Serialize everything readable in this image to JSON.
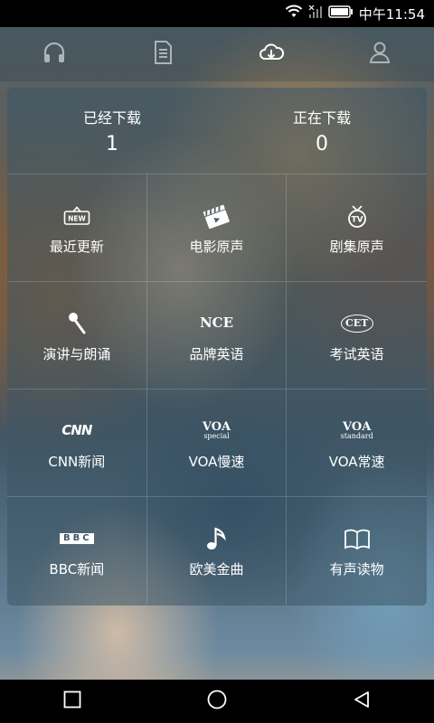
{
  "status_bar": {
    "time": "中午11:54"
  },
  "top_tabs": [
    {
      "name": "headphones"
    },
    {
      "name": "document"
    },
    {
      "name": "cloud-download"
    },
    {
      "name": "user"
    }
  ],
  "downloads": {
    "downloaded_label": "已经下载",
    "downloaded_count": "1",
    "downloading_label": "正在下载",
    "downloading_count": "0"
  },
  "categories": [
    {
      "label": "最近更新",
      "icon": "new-badge"
    },
    {
      "label": "电影原声",
      "icon": "clapperboard"
    },
    {
      "label": "剧集原声",
      "icon": "tv"
    },
    {
      "label": "演讲与朗诵",
      "icon": "microphone"
    },
    {
      "label": "品牌英语",
      "icon": "nce-logo",
      "logo": "NCE"
    },
    {
      "label": "考试英语",
      "icon": "cet-logo",
      "logo": "CET"
    },
    {
      "label": "CNN新闻",
      "icon": "cnn-logo",
      "logo": "CNN"
    },
    {
      "label": "VOA慢速",
      "icon": "voa-special-logo",
      "logo": "VOA",
      "logo_sub": "special"
    },
    {
      "label": "VOA常速",
      "icon": "voa-standard-logo",
      "logo": "VOA",
      "logo_sub": "standard"
    },
    {
      "label": "BBC新闻",
      "icon": "bbc-logo",
      "logo": "BBC"
    },
    {
      "label": "欧美金曲",
      "icon": "music-note"
    },
    {
      "label": "有声读物",
      "icon": "open-book"
    }
  ],
  "colors": {
    "active_tab": "#ffffff",
    "inactive_tab": "#aab4ba"
  }
}
